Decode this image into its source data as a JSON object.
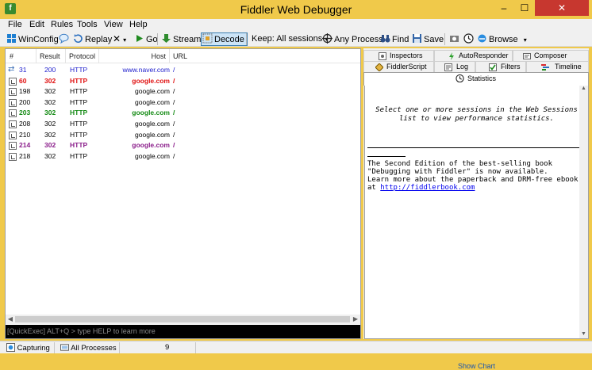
{
  "window": {
    "title": "Fiddler Web Debugger",
    "minimize_glyph": "‒",
    "maximize_glyph": "☐",
    "close_glyph": "✕"
  },
  "menu": [
    "File",
    "Edit",
    "Rules",
    "Tools",
    "View",
    "Help"
  ],
  "toolbar": {
    "winconfig": "WinConfig",
    "replay": "Replay",
    "remove_glyph": "✕",
    "dropdown_glyph": "▾",
    "go": "Go",
    "stream": "Stream",
    "decode": "Decode",
    "keep": "Keep: All sessions",
    "any_process": "Any Process",
    "find": "Find",
    "save": "Save",
    "browse": "Browse"
  },
  "sessions": {
    "columns": [
      "#",
      "Result",
      "Protocol",
      "Host",
      "URL"
    ],
    "rows": [
      {
        "num": "31",
        "result": "200",
        "protocol": "HTTP",
        "host": "www.naver.com",
        "url": "/",
        "color": "#1a1acc",
        "bold": false,
        "icon": "arrows-icon"
      },
      {
        "num": "60",
        "result": "302",
        "protocol": "HTTP",
        "host": "google.com",
        "url": "/",
        "color": "#e01010",
        "bold": true,
        "icon": "response-icon"
      },
      {
        "num": "198",
        "result": "302",
        "protocol": "HTTP",
        "host": "google.com",
        "url": "/",
        "color": "#000000",
        "bold": false,
        "icon": "response-icon"
      },
      {
        "num": "200",
        "result": "302",
        "protocol": "HTTP",
        "host": "google.com",
        "url": "/",
        "color": "#000000",
        "bold": false,
        "icon": "response-icon"
      },
      {
        "num": "203",
        "result": "302",
        "protocol": "HTTP",
        "host": "google.com",
        "url": "/",
        "color": "#138a13",
        "bold": true,
        "icon": "response-icon"
      },
      {
        "num": "208",
        "result": "302",
        "protocol": "HTTP",
        "host": "google.com",
        "url": "/",
        "color": "#000000",
        "bold": false,
        "icon": "response-icon"
      },
      {
        "num": "210",
        "result": "302",
        "protocol": "HTTP",
        "host": "google.com",
        "url": "/",
        "color": "#000000",
        "bold": false,
        "icon": "response-icon"
      },
      {
        "num": "214",
        "result": "302",
        "protocol": "HTTP",
        "host": "google.com",
        "url": "/",
        "color": "#8a1c8a",
        "bold": true,
        "icon": "response-icon"
      },
      {
        "num": "218",
        "result": "302",
        "protocol": "HTTP",
        "host": "google.com",
        "url": "/",
        "color": "#000000",
        "bold": false,
        "icon": "response-icon"
      }
    ],
    "quickexec_placeholder": "[QuickExec] ALT+Q > type HELP to learn more"
  },
  "tabs": {
    "row1": [
      "Inspectors",
      "AutoResponder",
      "Composer"
    ],
    "row2": [
      "FiddlerScript",
      "Log",
      "Filters",
      "Timeline"
    ],
    "active": "Statistics"
  },
  "statistics": {
    "message_line1": "Select one or more sessions in the Web Sessions",
    "message_line2": "list to view performance statistics.",
    "promo_line1": "The Second Edition of the best-selling book",
    "promo_line2": "\"Debugging with Fiddler\" is now available.",
    "promo_line3": "Learn more about the paperback and DRM-free ebook",
    "promo_prefix": "at ",
    "promo_link": "http://fiddlerbook.com",
    "show_chart": "Show Chart"
  },
  "status": {
    "capturing": "Capturing",
    "processes": "All Processes",
    "count": "9"
  }
}
